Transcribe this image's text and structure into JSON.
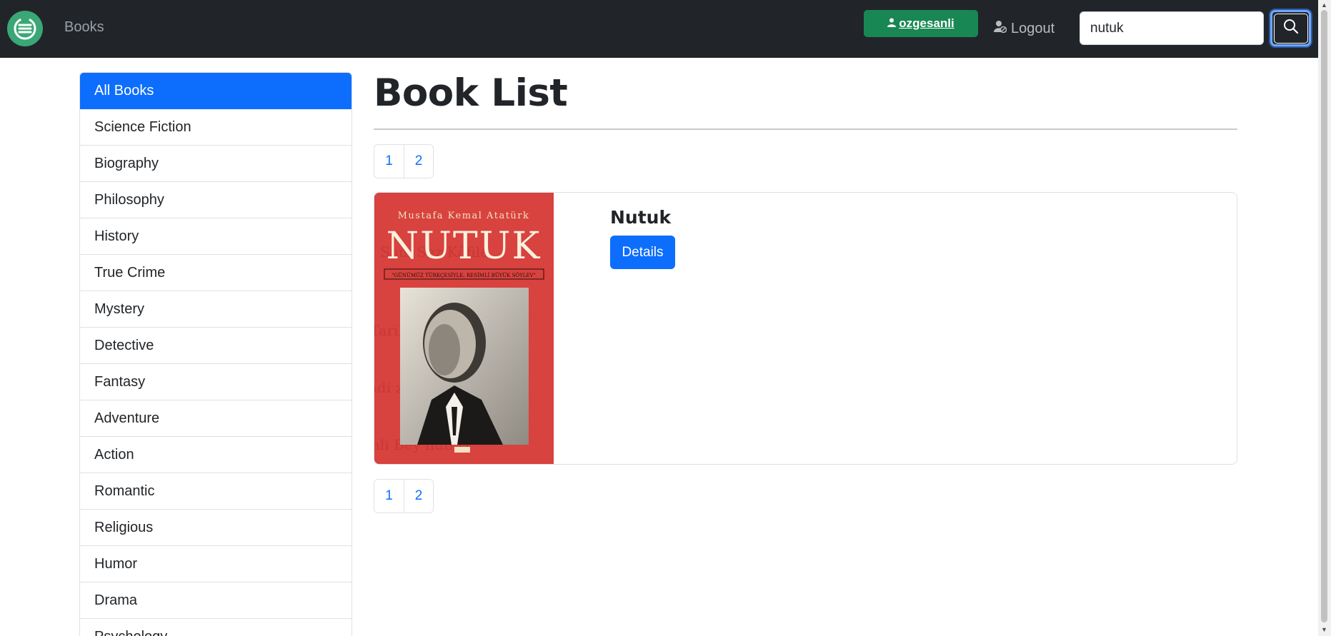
{
  "navbar": {
    "brand_name": "Books",
    "username": "ozgesanli",
    "logout_label": "Logout",
    "search_value": "nutuk"
  },
  "sidebar": {
    "items": [
      {
        "label": "All Books",
        "active": true
      },
      {
        "label": "Science Fiction"
      },
      {
        "label": "Biography"
      },
      {
        "label": "Philosophy"
      },
      {
        "label": "History"
      },
      {
        "label": "True Crime"
      },
      {
        "label": "Mystery"
      },
      {
        "label": "Detective"
      },
      {
        "label": "Fantasy"
      },
      {
        "label": "Adventure"
      },
      {
        "label": "Action"
      },
      {
        "label": "Romantic"
      },
      {
        "label": "Religious"
      },
      {
        "label": "Humor"
      },
      {
        "label": "Drama"
      },
      {
        "label": "Psychology"
      }
    ]
  },
  "main": {
    "title": "Book List",
    "pagination": [
      "1",
      "2"
    ],
    "books": [
      {
        "title": "Nutuk",
        "details_label": "Details",
        "cover": {
          "author": "Mustafa Kemal Atatürk",
          "title": "NUTUK",
          "subtitle": "\"GÜNÜMÜZ TÜRKÇESİYLE, RESİMLİ BÜYÜK SÖYLEV\""
        }
      }
    ]
  },
  "colors": {
    "navbar_bg": "#212529",
    "primary": "#0d6efd",
    "success": "#198754",
    "cover_red": "#d8423f"
  }
}
